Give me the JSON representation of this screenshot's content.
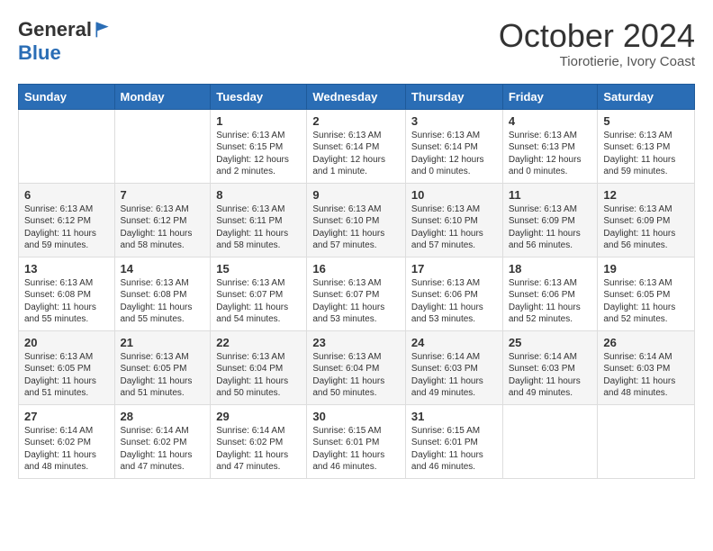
{
  "logo": {
    "general": "General",
    "blue": "Blue"
  },
  "header": {
    "month": "October 2024",
    "location": "Tiorotierie, Ivory Coast"
  },
  "days_of_week": [
    "Sunday",
    "Monday",
    "Tuesday",
    "Wednesday",
    "Thursday",
    "Friday",
    "Saturday"
  ],
  "weeks": [
    [
      null,
      null,
      {
        "day": "1",
        "sunrise": "6:13 AM",
        "sunset": "6:15 PM",
        "daylight": "12 hours and 2 minutes."
      },
      {
        "day": "2",
        "sunrise": "6:13 AM",
        "sunset": "6:14 PM",
        "daylight": "12 hours and 1 minute."
      },
      {
        "day": "3",
        "sunrise": "6:13 AM",
        "sunset": "6:14 PM",
        "daylight": "12 hours and 0 minutes."
      },
      {
        "day": "4",
        "sunrise": "6:13 AM",
        "sunset": "6:13 PM",
        "daylight": "12 hours and 0 minutes."
      },
      {
        "day": "5",
        "sunrise": "6:13 AM",
        "sunset": "6:13 PM",
        "daylight": "11 hours and 59 minutes."
      }
    ],
    [
      {
        "day": "6",
        "sunrise": "6:13 AM",
        "sunset": "6:12 PM",
        "daylight": "11 hours and 59 minutes."
      },
      {
        "day": "7",
        "sunrise": "6:13 AM",
        "sunset": "6:12 PM",
        "daylight": "11 hours and 58 minutes."
      },
      {
        "day": "8",
        "sunrise": "6:13 AM",
        "sunset": "6:11 PM",
        "daylight": "11 hours and 58 minutes."
      },
      {
        "day": "9",
        "sunrise": "6:13 AM",
        "sunset": "6:10 PM",
        "daylight": "11 hours and 57 minutes."
      },
      {
        "day": "10",
        "sunrise": "6:13 AM",
        "sunset": "6:10 PM",
        "daylight": "11 hours and 57 minutes."
      },
      {
        "day": "11",
        "sunrise": "6:13 AM",
        "sunset": "6:09 PM",
        "daylight": "11 hours and 56 minutes."
      },
      {
        "day": "12",
        "sunrise": "6:13 AM",
        "sunset": "6:09 PM",
        "daylight": "11 hours and 56 minutes."
      }
    ],
    [
      {
        "day": "13",
        "sunrise": "6:13 AM",
        "sunset": "6:08 PM",
        "daylight": "11 hours and 55 minutes."
      },
      {
        "day": "14",
        "sunrise": "6:13 AM",
        "sunset": "6:08 PM",
        "daylight": "11 hours and 55 minutes."
      },
      {
        "day": "15",
        "sunrise": "6:13 AM",
        "sunset": "6:07 PM",
        "daylight": "11 hours and 54 minutes."
      },
      {
        "day": "16",
        "sunrise": "6:13 AM",
        "sunset": "6:07 PM",
        "daylight": "11 hours and 53 minutes."
      },
      {
        "day": "17",
        "sunrise": "6:13 AM",
        "sunset": "6:06 PM",
        "daylight": "11 hours and 53 minutes."
      },
      {
        "day": "18",
        "sunrise": "6:13 AM",
        "sunset": "6:06 PM",
        "daylight": "11 hours and 52 minutes."
      },
      {
        "day": "19",
        "sunrise": "6:13 AM",
        "sunset": "6:05 PM",
        "daylight": "11 hours and 52 minutes."
      }
    ],
    [
      {
        "day": "20",
        "sunrise": "6:13 AM",
        "sunset": "6:05 PM",
        "daylight": "11 hours and 51 minutes."
      },
      {
        "day": "21",
        "sunrise": "6:13 AM",
        "sunset": "6:05 PM",
        "daylight": "11 hours and 51 minutes."
      },
      {
        "day": "22",
        "sunrise": "6:13 AM",
        "sunset": "6:04 PM",
        "daylight": "11 hours and 50 minutes."
      },
      {
        "day": "23",
        "sunrise": "6:13 AM",
        "sunset": "6:04 PM",
        "daylight": "11 hours and 50 minutes."
      },
      {
        "day": "24",
        "sunrise": "6:14 AM",
        "sunset": "6:03 PM",
        "daylight": "11 hours and 49 minutes."
      },
      {
        "day": "25",
        "sunrise": "6:14 AM",
        "sunset": "6:03 PM",
        "daylight": "11 hours and 49 minutes."
      },
      {
        "day": "26",
        "sunrise": "6:14 AM",
        "sunset": "6:03 PM",
        "daylight": "11 hours and 48 minutes."
      }
    ],
    [
      {
        "day": "27",
        "sunrise": "6:14 AM",
        "sunset": "6:02 PM",
        "daylight": "11 hours and 48 minutes."
      },
      {
        "day": "28",
        "sunrise": "6:14 AM",
        "sunset": "6:02 PM",
        "daylight": "11 hours and 47 minutes."
      },
      {
        "day": "29",
        "sunrise": "6:14 AM",
        "sunset": "6:02 PM",
        "daylight": "11 hours and 47 minutes."
      },
      {
        "day": "30",
        "sunrise": "6:15 AM",
        "sunset": "6:01 PM",
        "daylight": "11 hours and 46 minutes."
      },
      {
        "day": "31",
        "sunrise": "6:15 AM",
        "sunset": "6:01 PM",
        "daylight": "11 hours and 46 minutes."
      },
      null,
      null
    ]
  ]
}
